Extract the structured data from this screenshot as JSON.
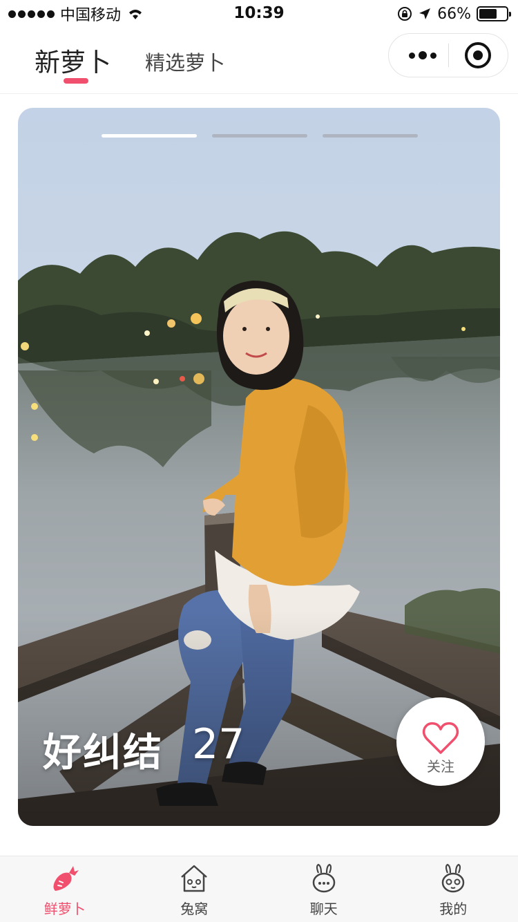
{
  "status_bar": {
    "carrier": "中国移动",
    "time": "10:39",
    "battery_percent": "66%",
    "battery_level": 0.66,
    "icons": [
      "signal-icon",
      "wifi-icon",
      "orientation-lock-icon",
      "location-arrow-icon",
      "battery-icon"
    ]
  },
  "header": {
    "tabs": [
      {
        "label": "新萝卜",
        "active": true
      },
      {
        "label": "精选萝卜",
        "active": false
      }
    ],
    "capsule": {
      "more_icon": "more-dots-icon",
      "close_icon": "target-close-icon"
    }
  },
  "card": {
    "photo_count": 3,
    "active_photo": 1,
    "name": "好纠结",
    "age": "27",
    "follow_label": "关注",
    "follow_icon": "heart-outline-icon"
  },
  "tabbar": {
    "items": [
      {
        "label": "鲜萝卜",
        "icon": "carrot-icon",
        "active": true
      },
      {
        "label": "兔窝",
        "icon": "rabbit-house-icon",
        "active": false
      },
      {
        "label": "聊天",
        "icon": "rabbit-chat-icon",
        "active": false
      },
      {
        "label": "我的",
        "icon": "rabbit-face-icon",
        "active": false
      }
    ]
  },
  "colors": {
    "accent": "#f0506e",
    "text": "#222222",
    "tabbar_bg": "#f7f7f7"
  }
}
